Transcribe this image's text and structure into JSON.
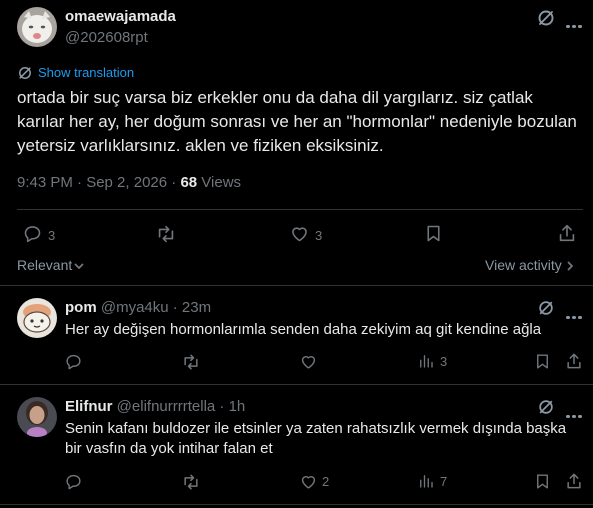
{
  "tweet": {
    "display_name": "omaewajamada",
    "handle": "@202608rpt",
    "show_translation": "Show translation",
    "text": "ortada bir suç varsa biz erkekler onu da daha dil yargılarız. siz çatlak karılar her ay, her doğum sonrası ve her an \"hormonlar\" nedeniyle bozulan yetersiz varlıklarsınız. aklen ve fiziken eksiksiniz.",
    "timestamp": "9:43 PM · Sep 2, 2026 · ",
    "views_count": "68",
    "views_label": " Views",
    "reply_count": "3",
    "like_count": "3"
  },
  "sort": {
    "label": "Relevant",
    "view_activity": "View activity"
  },
  "replies": [
    {
      "display_name": "pom",
      "handle": "@mya4ku · 23m",
      "text": "Her ay değişen hormonlarımla senden daha zekiyim aq git kendine ağla",
      "views_count": "3"
    },
    {
      "display_name": "Elifnur",
      "handle": "@elifnurrrrtella · 1h",
      "text": "Senin kafanı buldozer ile etsinler ya zaten rahatsızlık vermek dışında başka bir vasfın da yok intihar falan et",
      "like_count": "2",
      "views_count": "7"
    }
  ],
  "colors": {
    "background": "#000000",
    "text": "#e7e9ea",
    "muted": "#71767b",
    "accent": "#1d9bf0",
    "divider": "#2f3336"
  },
  "icons": [
    "grok-icon",
    "more-icon",
    "translate-icon",
    "reply-icon",
    "retweet-icon",
    "like-icon",
    "bookmark-icon",
    "share-icon",
    "views-icon",
    "chevron-down-icon",
    "chevron-right-icon"
  ]
}
